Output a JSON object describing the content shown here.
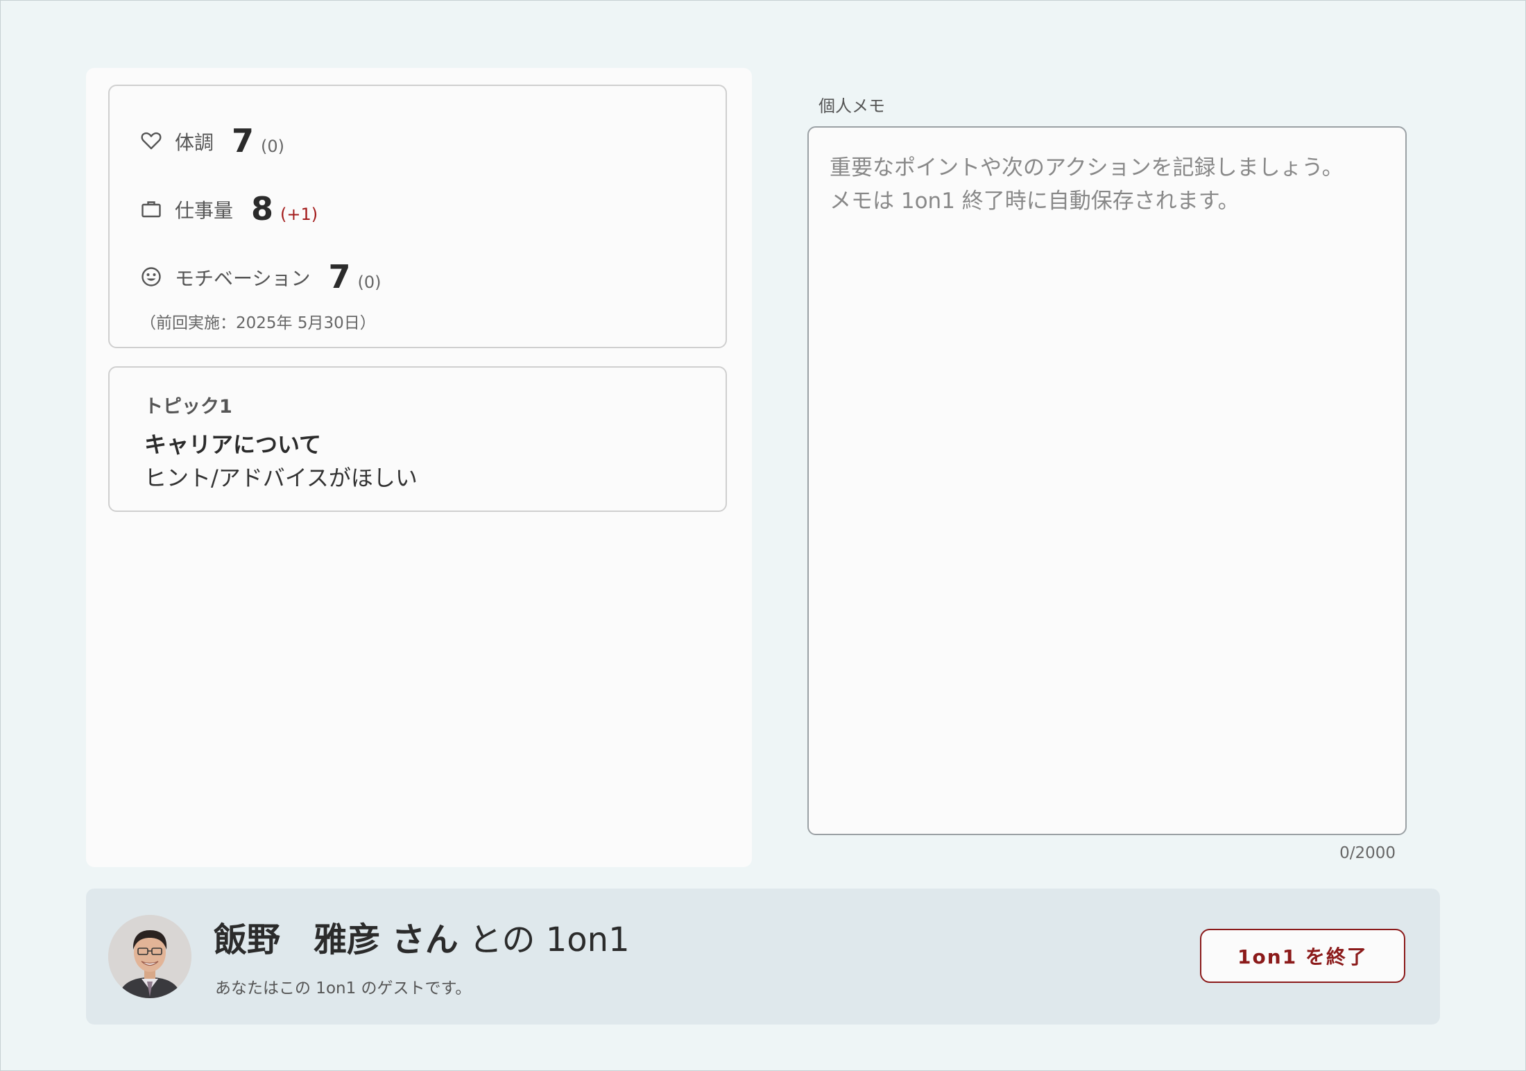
{
  "metrics": {
    "items": [
      {
        "icon": "heart-icon",
        "label": "体調",
        "value": "7",
        "diff": "(0)"
      },
      {
        "icon": "briefcase-icon",
        "label": "仕事量",
        "value": "8",
        "diff": "(+1)"
      },
      {
        "icon": "smiley-icon",
        "label": "モチベーション",
        "value": "7",
        "diff": "(0)"
      }
    ],
    "last_date": "（前回実施：2025年 5月30日）"
  },
  "topic": {
    "label": "トピック1",
    "title": "キャリアについて",
    "subtitle": "ヒント/アドバイスがほしい"
  },
  "memo": {
    "label": "個人メモ",
    "value": "",
    "placeholder": "重要なポイントや次のアクションを記録しましょう。\nメモは 1on1 終了時に自動保存されます。",
    "count": "0/2000"
  },
  "footer": {
    "name": "飯野　雅彦 さん",
    "title_suffix": " との 1on1",
    "subtitle": "あなたはこの 1on1 のゲストです。",
    "end_button": "1on1 を終了"
  },
  "colors": {
    "background": "#eef5f6",
    "accent": "#8b1a1a",
    "diff_up": "#a31b1b",
    "footer_bg": "#dfe8ec"
  }
}
